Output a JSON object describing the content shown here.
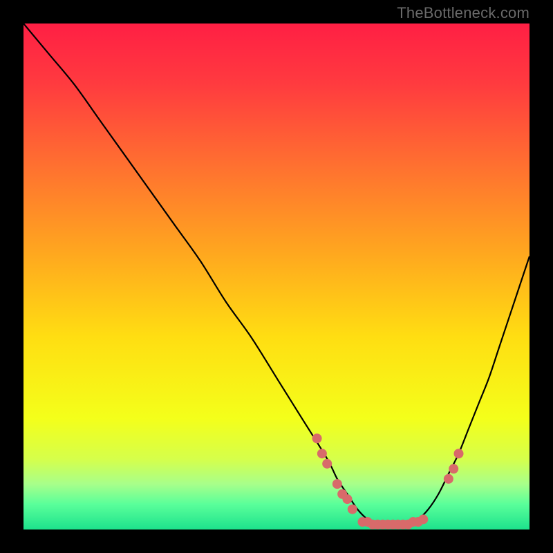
{
  "attribution": "TheBottleneck.com",
  "chart_data": {
    "type": "line",
    "title": "",
    "xlabel": "",
    "ylabel": "",
    "xlim": [
      0,
      100
    ],
    "ylim": [
      0,
      100
    ],
    "background_gradient_stops": [
      {
        "offset": 0.0,
        "color": "#ff1f44"
      },
      {
        "offset": 0.12,
        "color": "#ff3b3f"
      },
      {
        "offset": 0.28,
        "color": "#ff7030"
      },
      {
        "offset": 0.45,
        "color": "#ffa61f"
      },
      {
        "offset": 0.62,
        "color": "#ffde12"
      },
      {
        "offset": 0.78,
        "color": "#f4ff1a"
      },
      {
        "offset": 0.86,
        "color": "#d6ff4a"
      },
      {
        "offset": 0.91,
        "color": "#a8ff8a"
      },
      {
        "offset": 0.95,
        "color": "#5aff9a"
      },
      {
        "offset": 1.0,
        "color": "#1de28c"
      }
    ],
    "series": [
      {
        "name": "bottleneck-curve",
        "x": [
          0,
          5,
          10,
          15,
          20,
          25,
          30,
          35,
          40,
          45,
          50,
          55,
          60,
          62,
          64,
          66,
          68,
          70,
          72,
          74,
          76,
          78,
          80,
          82,
          84,
          86,
          88,
          90,
          92,
          94,
          96,
          98,
          100
        ],
        "y": [
          100,
          94,
          88,
          81,
          74,
          67,
          60,
          53,
          45,
          38,
          30,
          22,
          14,
          10,
          7,
          4,
          2,
          1,
          0.5,
          0.5,
          1,
          2,
          4,
          7,
          11,
          15,
          20,
          25,
          30,
          36,
          42,
          48,
          54
        ]
      }
    ],
    "markers": {
      "name": "sample-points",
      "color": "#d86a6a",
      "radius": 7,
      "points": [
        {
          "x": 58,
          "y": 18
        },
        {
          "x": 59,
          "y": 15
        },
        {
          "x": 60,
          "y": 13
        },
        {
          "x": 62,
          "y": 9
        },
        {
          "x": 63,
          "y": 7
        },
        {
          "x": 64,
          "y": 6
        },
        {
          "x": 65,
          "y": 4
        },
        {
          "x": 67,
          "y": 1.5
        },
        {
          "x": 68,
          "y": 1.5
        },
        {
          "x": 69,
          "y": 1
        },
        {
          "x": 70,
          "y": 1
        },
        {
          "x": 71,
          "y": 1
        },
        {
          "x": 72,
          "y": 1
        },
        {
          "x": 73,
          "y": 1
        },
        {
          "x": 74,
          "y": 1
        },
        {
          "x": 75,
          "y": 1
        },
        {
          "x": 76,
          "y": 1
        },
        {
          "x": 77,
          "y": 1.5
        },
        {
          "x": 78,
          "y": 1.5
        },
        {
          "x": 79,
          "y": 2
        },
        {
          "x": 84,
          "y": 10
        },
        {
          "x": 85,
          "y": 12
        },
        {
          "x": 86,
          "y": 15
        }
      ]
    }
  }
}
